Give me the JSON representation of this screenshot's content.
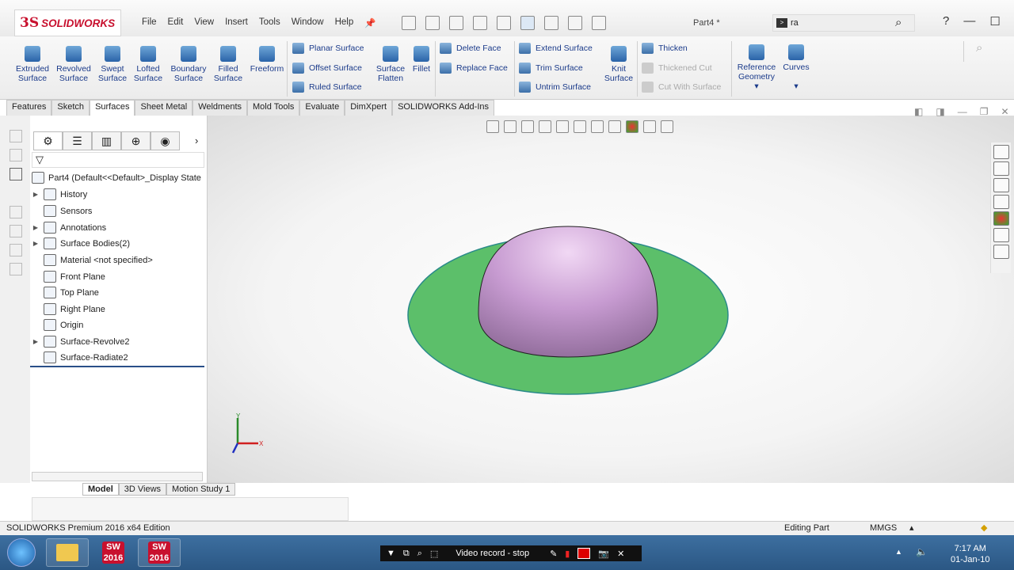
{
  "app": {
    "brand_ds": "3S",
    "brand_name": "SOLIDWORKS",
    "doc_title": "Part4 *"
  },
  "menu": [
    "File",
    "Edit",
    "View",
    "Insert",
    "Tools",
    "Window",
    "Help"
  ],
  "search": {
    "value": "ra"
  },
  "window_controls": [
    "?",
    "—",
    "☐",
    "✕"
  ],
  "ribbon": {
    "large": [
      {
        "l1": "Extruded",
        "l2": "Surface"
      },
      {
        "l1": "Revolved",
        "l2": "Surface"
      },
      {
        "l1": "Swept",
        "l2": "Surface"
      },
      {
        "l1": "Lofted",
        "l2": "Surface"
      },
      {
        "l1": "Boundary",
        "l2": "Surface"
      },
      {
        "l1": "Filled",
        "l2": "Surface"
      },
      {
        "l1": "Freeform",
        "l2": ""
      }
    ],
    "surf_col": [
      "Planar Surface",
      "Offset Surface",
      "Ruled Surface"
    ],
    "flatten": {
      "l1": "Surface",
      "l2": "Flatten"
    },
    "fillet": "Fillet",
    "face_col": [
      "Delete Face",
      "Replace Face"
    ],
    "extend_col": [
      "Extend Surface",
      "Trim Surface",
      "Untrim Surface"
    ],
    "knit": {
      "l1": "Knit",
      "l2": "Surface"
    },
    "thicken_col": [
      "Thicken",
      "Thickened Cut",
      "Cut With Surface"
    ],
    "refgeo": {
      "l1": "Reference",
      "l2": "Geometry"
    },
    "curves": "Curves"
  },
  "tabs": [
    "Features",
    "Sketch",
    "Surfaces",
    "Sheet Metal",
    "Weldments",
    "Mold Tools",
    "Evaluate",
    "DimXpert",
    "SOLIDWORKS Add-Ins"
  ],
  "active_tab": "Surfaces",
  "tree": {
    "root": "Part4  (Default<<Default>_Display State",
    "items": [
      {
        "label": "History",
        "expand": true
      },
      {
        "label": "Sensors",
        "expand": false
      },
      {
        "label": "Annotations",
        "expand": true
      },
      {
        "label": "Surface Bodies(2)",
        "expand": true
      },
      {
        "label": "Material <not specified>",
        "expand": false
      },
      {
        "label": "Front Plane",
        "expand": false
      },
      {
        "label": "Top Plane",
        "expand": false
      },
      {
        "label": "Right Plane",
        "expand": false
      },
      {
        "label": "Origin",
        "expand": false
      },
      {
        "label": "Surface-Revolve2",
        "expand": true
      },
      {
        "label": "Surface-Radiate2",
        "expand": false
      }
    ]
  },
  "bottom_tabs": [
    "Model",
    "3D Views",
    "Motion Study 1"
  ],
  "status": {
    "left": "SOLIDWORKS Premium 2016 x64 Edition",
    "mode": "Editing Part",
    "units": "MMGS"
  },
  "triad": {
    "x": "X",
    "y": "Y"
  },
  "model_colors": {
    "disk": "#5cbf6a",
    "dome": "#c79bd1",
    "disk_edge": "#2a8a8a"
  },
  "taskbar": {
    "sw1": "SW\n2016",
    "sw2": "SW\n2016",
    "rec_label": "Video record - stop",
    "time": "7:17 AM",
    "date": "01-Jan-10"
  }
}
